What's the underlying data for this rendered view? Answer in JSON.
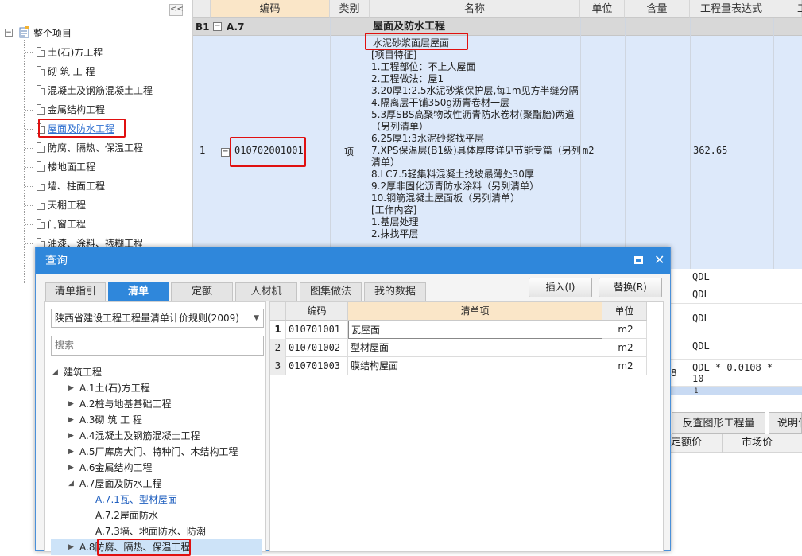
{
  "left_tree": {
    "collapse_glyph": "<<",
    "root_toggle": "−",
    "root": "整个项目",
    "items": [
      "土(石)方工程",
      "砌 筑 工 程",
      "混凝土及钢筋混凝土工程",
      "金属结构工程",
      "屋面及防水工程",
      "防腐、隔热、保温工程",
      "楼地面工程",
      "墙、柱面工程",
      "天棚工程",
      "门窗工程",
      "油漆、涂料、裱糊工程"
    ],
    "selected_index": 4
  },
  "grid": {
    "headers": [
      "编码",
      "类别",
      "名称",
      "单位",
      "含量",
      "工程量表达式",
      "工"
    ],
    "b1_row": {
      "tag": "B1",
      "toggle": "−",
      "code": "A.7",
      "name": "屋面及防水工程"
    },
    "row1": {
      "index": "1",
      "toggle": "−",
      "code": "010702001001",
      "type": "项",
      "name": "水泥砂浆面层屋面",
      "description": "[项目特征]\n1.工程部位：不上人屋面\n2.工程做法：屋1\n3.20厚1:2.5水泥砂浆保护层,每1m见方半缝分隔\n4.隔离层干铺350g沥青卷材一层\n5.3厚SBS高聚物改性沥青防水卷材(聚酯胎)两道（另列清单）\n6.25厚1:3水泥砂浆找平层\n7.XPS保温层(B1级)具体厚度详见节能专篇（另列清单）\n8.LC7.5轻集料混凝土找坡最薄处30厚\n9.2厚非固化沥青防水涂料（另列清单）\n10.钢筋混凝土屋面板（另列清单）\n[工作内容]\n1.基层处理\n2.抹找平层",
      "unit": "m2",
      "quantity_expr": "362.65"
    },
    "sub_rows": [
      "QDL",
      "QDL",
      "QDL",
      "QDL",
      "QDL * 0.0108 *\n10"
    ],
    "partial_digit": "8",
    "partial_row_text": "1",
    "bottom_tabs": [
      "反查图形工程量",
      "说明信"
    ],
    "bottom_headers": [
      "定额价",
      "市场价"
    ]
  },
  "dialog": {
    "title": "查询",
    "close_glyph": "✕",
    "tabs": [
      "清单指引",
      "清单",
      "定额",
      "人材机",
      "图集做法",
      "我的数据"
    ],
    "active_tab": 1,
    "insert_button": "插入(I)",
    "replace_button": "替换(R)",
    "select_value": "陕西省建设工程工程量清单计价规则(2009)",
    "select_arrow": "▼",
    "search_placeholder": "搜索",
    "tree": [
      {
        "label": "建筑工程",
        "depth": 0,
        "arrow": "◢"
      },
      {
        "label": "A.1土(石)方工程",
        "depth": 1,
        "arrow": "▶"
      },
      {
        "label": "A.2桩与地基基础工程",
        "depth": 1,
        "arrow": "▶"
      },
      {
        "label": "A.3砌 筑 工 程",
        "depth": 1,
        "arrow": "▶"
      },
      {
        "label": "A.4混凝土及钢筋混凝土工程",
        "depth": 1,
        "arrow": "▶"
      },
      {
        "label": "A.5厂库房大门、特种门、木结构工程",
        "depth": 1,
        "arrow": "▶"
      },
      {
        "label": "A.6金属结构工程",
        "depth": 1,
        "arrow": "▶"
      },
      {
        "label": "A.7屋面及防水工程",
        "depth": 1,
        "arrow": "◢"
      },
      {
        "label": "A.7.1瓦、型材屋面",
        "depth": 2,
        "arrow": ""
      },
      {
        "label": "A.7.2屋面防水",
        "depth": 2,
        "arrow": ""
      },
      {
        "label": "A.7.3墙、地面防水、防潮",
        "depth": 2,
        "arrow": ""
      },
      {
        "label": "A.8防腐、隔热、保温工程",
        "depth": 1,
        "arrow": "▶"
      }
    ],
    "table_headers": [
      "",
      "编码",
      "清单项",
      "单位"
    ],
    "table_rows": [
      {
        "n": "1",
        "code": "010701001",
        "name": "瓦屋面",
        "unit": "m2"
      },
      {
        "n": "2",
        "code": "010701002",
        "name": "型材屋面",
        "unit": "m2"
      },
      {
        "n": "3",
        "code": "010701003",
        "name": "膜结构屋面",
        "unit": "m2"
      }
    ]
  },
  "colors": {
    "accent": "#2f87db",
    "highlight_header": "#fae6c8",
    "row_selected": "#dde9fa",
    "callout": "#e01010"
  }
}
